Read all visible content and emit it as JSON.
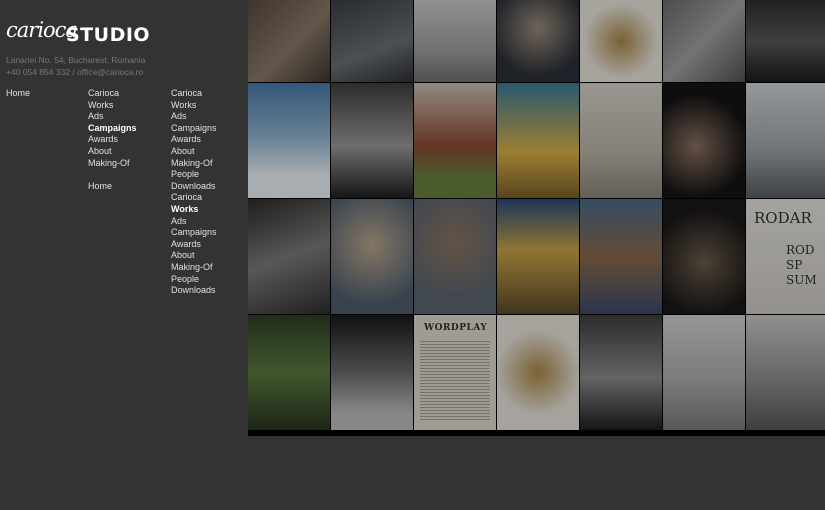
{
  "brand": {
    "logo_script": "carioca",
    "logo_word": "STUDIO"
  },
  "address": {
    "line1": "Lanariei No. 54, Bucharest, Romania",
    "line2": "+40 054 854 332 / office@carioca.ro"
  },
  "nav": {
    "col1": [
      {
        "label": "Home"
      }
    ],
    "col2": [
      {
        "label": "Carioca"
      },
      {
        "label": "Works"
      },
      {
        "label": "Ads"
      },
      {
        "label": "Campaigns",
        "active": true
      },
      {
        "label": "Awards"
      },
      {
        "label": "About"
      },
      {
        "label": "Making-Of"
      },
      {
        "gap": true
      },
      {
        "label": "Home"
      }
    ],
    "col3": [
      {
        "label": "Carioca"
      },
      {
        "label": "Works"
      },
      {
        "label": "Ads"
      },
      {
        "label": "Campaigns"
      },
      {
        "label": "Awards"
      },
      {
        "label": "About"
      },
      {
        "label": "Making-Of"
      },
      {
        "label": "People"
      },
      {
        "label": "Downloads"
      },
      {
        "label": "Carioca"
      },
      {
        "label": "Works",
        "active": true
      },
      {
        "label": "Ads"
      },
      {
        "label": "Campaigns"
      },
      {
        "label": "Awards"
      },
      {
        "label": "About"
      },
      {
        "label": "Making-Of"
      },
      {
        "label": "People"
      },
      {
        "label": "Downloads"
      }
    ]
  },
  "gallery": {
    "tiles": [
      {
        "name": "woman-portrait-tile",
        "bg": "linear-gradient(135deg,#5a4a3e,#8a7868 55%,#3e3630)"
      },
      {
        "name": "cyclist-street-tile",
        "bg": "linear-gradient(160deg,#3a3d42,#6a6e74 60%,#2e3134)"
      },
      {
        "name": "white-car-tile",
        "bg": "linear-gradient(180deg,#c9c9c9,#9a9a9a 65%,#6e6e6e)"
      },
      {
        "name": "boy-suit-tile",
        "bg": "radial-gradient(circle at 50% 35%,#9a8c7c,#2c3038 70%)"
      },
      {
        "name": "gold-ornament-tile",
        "bg": "radial-gradient(circle at 50% 50%,#a88848,#e8e4dc 65%)"
      },
      {
        "name": "grey-abstract-tile",
        "bg": "linear-gradient(135deg,#6a6a6a,#a0a0a0 50%,#545454)"
      },
      {
        "name": "skyscraper-tile",
        "bg": "linear-gradient(180deg,#2e2e2e,#585858 50%,#1c1c1c)"
      },
      {
        "name": "polar-explorer-tile",
        "bg": "linear-gradient(180deg,#4a78a8,#8ab0cc 45%,#e8f0f4 80%)"
      },
      {
        "name": "arch-gate-tile",
        "bg": "linear-gradient(180deg,#3e3e3e,#989898 55%,#1e1e1e)"
      },
      {
        "name": "round-barn-tile",
        "bg": "linear-gradient(180deg,#c8c0b0,#8a4a32 55%,#6a7e3e 80%)"
      },
      {
        "name": "jumping-man-tile",
        "bg": "linear-gradient(180deg,#3a7a9a,#d8b048 60%,#7a6028)"
      },
      {
        "name": "cats-tile",
        "bg": "linear-gradient(180deg,#d4d0c8,#bab4a8 60%,#8a847a)"
      },
      {
        "name": "hands-dark-tile",
        "bg": "radial-gradient(circle at 40% 55%,#8a7060,#141414 65%)"
      },
      {
        "name": "white-horses-tile",
        "bg": "linear-gradient(180deg,#cfd3d6,#9aa0a4 60%,#585c5e)"
      },
      {
        "name": "children-car-tile",
        "bg": "linear-gradient(160deg,#2a2a2a,#7a7a7a 50%,#2e2e2e)"
      },
      {
        "name": "girl-portrait-tile",
        "bg": "radial-gradient(circle at 50% 40%,#b8a48c,#4e5e6e 75%)"
      },
      {
        "name": "man-seatbelt-tile",
        "bg": "radial-gradient(circle at 50% 38%,#8a7460,#5a6470 70%)"
      },
      {
        "name": "market-stalls-tile",
        "bg": "linear-gradient(180deg,#2a4a7a,#c8a448 45%,#5a4a2a)"
      },
      {
        "name": "shopping-aisles-tile",
        "bg": "linear-gradient(180deg,#4a6a8a,#8a6a4a 50%,#3a4a6a)"
      },
      {
        "name": "dark-figure-tile",
        "bg": "radial-gradient(circle at 50% 55%,#6a5a4a,#1a1818 70%)"
      },
      {
        "name": "magazine-spread-tile",
        "bg": "linear-gradient(180deg,#e4e2de,#cecac4)"
      },
      {
        "name": "forest-treehouse-tile",
        "bg": "linear-gradient(180deg,#2e3e26,#5a7a3e 50%,#2a3420)"
      },
      {
        "name": "light-rays-tile",
        "bg": "linear-gradient(180deg,#181818,#6a6a6a 50%,#bcbcbc 85%)"
      },
      {
        "name": "wordplay-tile",
        "bg": "#ddd8cc"
      },
      {
        "name": "gold-mannequin-tile",
        "bg": "radial-gradient(circle at 50% 50%,#a88848,#e6e2da 60%)"
      },
      {
        "name": "motorcycle-tile",
        "bg": "linear-gradient(180deg,#3e3e3e,#8a8a8a 55%,#1e1e1e)"
      },
      {
        "name": "living-room-tile",
        "bg": "linear-gradient(180deg,#d0d0d0,#a8a8a8 60%,#7a7a7a)"
      },
      {
        "name": "interior-shelves-tile",
        "bg": "linear-gradient(180deg,#c8c8c8,#8e8e8e 55%,#585858)"
      }
    ],
    "wordplay_title": "WORDPLAY",
    "banner_text": "RODAR",
    "banner_sub": "ROD SP SUM"
  }
}
